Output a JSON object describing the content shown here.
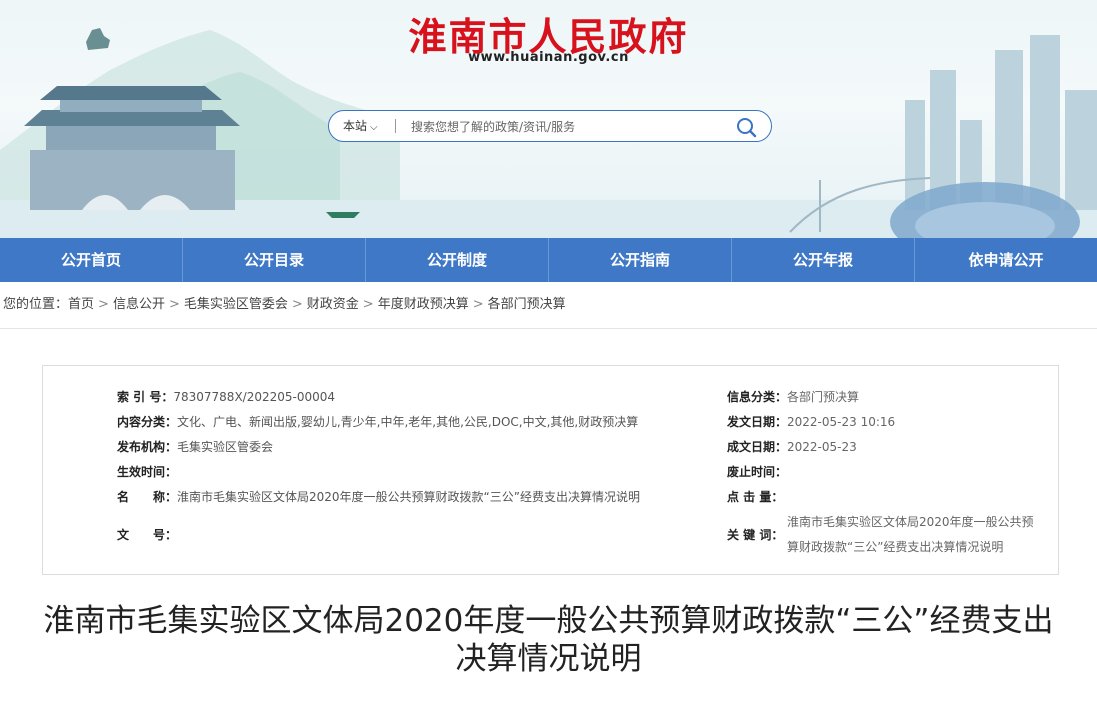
{
  "header": {
    "site_title": "淮南市人民政府",
    "site_url": "www.huainan.gov.cn"
  },
  "search": {
    "scope_label": "本站",
    "placeholder": "搜索您想了解的政策/资讯/服务"
  },
  "nav": {
    "items": [
      {
        "label": "公开首页"
      },
      {
        "label": "公开目录"
      },
      {
        "label": "公开制度"
      },
      {
        "label": "公开指南"
      },
      {
        "label": "公开年报"
      },
      {
        "label": "依申请公开"
      }
    ]
  },
  "breadcrumb": {
    "prefix": "您的位置：",
    "items": [
      "首页",
      "信息公开",
      "毛集实验区管委会",
      "财政资金",
      "年度财政预决算",
      "各部门预决算"
    ],
    "separator": ">"
  },
  "meta": {
    "index_no": {
      "label": "索 引 号：",
      "value": "78307788X/202205-00004"
    },
    "category": {
      "label": "信息分类：",
      "value": "各部门预决算"
    },
    "content_type": {
      "label": "内容分类：",
      "value": "文化、广电、新闻出版,婴幼儿,青少年,中年,老年,其他,公民,DOC,中文,其他,财政预决算"
    },
    "publish_date": {
      "label": "发文日期：",
      "value": "2022-05-23 10:16"
    },
    "publisher": {
      "label": "发布机构：",
      "value": "毛集实验区管委会"
    },
    "created_date": {
      "label": "成文日期：",
      "value": "2022-05-23"
    },
    "effective_date": {
      "label": "生效时间：",
      "value": ""
    },
    "expiry_date": {
      "label": "废止时间：",
      "value": ""
    },
    "name": {
      "label": "名　　称：",
      "value": "淮南市毛集实验区文体局2020年度一般公共预算财政拨款“三公”经费支出决算情况说明"
    },
    "clicks": {
      "label": "点 击 量：",
      "value": ""
    },
    "doc_no": {
      "label": "文　　号：",
      "value": ""
    },
    "keywords": {
      "label": "关 键 词：",
      "value": "淮南市毛集实验区文体局2020年度一般公共预算财政拨款“三公”经费支出决算情况说明"
    }
  },
  "article": {
    "title": "淮南市毛集实验区文体局2020年度一般公共预算财政拨款“三公”经费支出决算情况说明"
  },
  "colors": {
    "brand_red": "#d7121c",
    "nav_blue": "#3f78c6",
    "search_border": "#3a74c4"
  }
}
